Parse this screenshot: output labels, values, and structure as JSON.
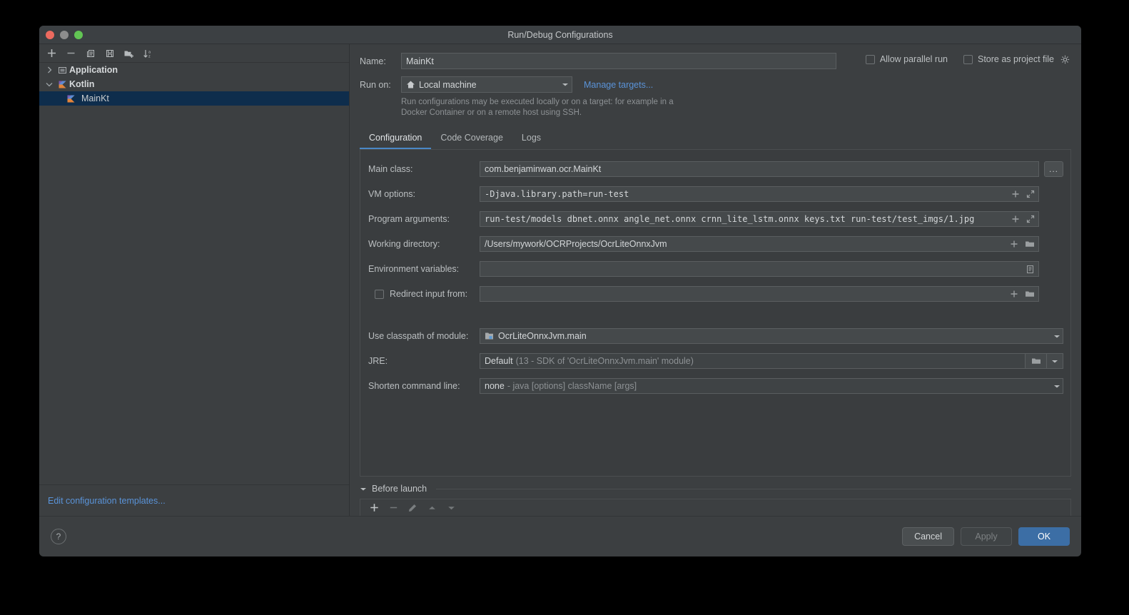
{
  "window": {
    "title": "Run/Debug Configurations",
    "traffic_lights": [
      "close-red",
      "minimize-gray",
      "zoom-green"
    ]
  },
  "tree_toolbar": {
    "buttons": [
      {
        "name": "add-configuration",
        "icon": "plus-icon"
      },
      {
        "name": "remove-configuration",
        "icon": "minus-icon"
      },
      {
        "name": "copy-configuration",
        "icon": "copy-icon"
      },
      {
        "name": "save-configuration",
        "icon": "save-icon"
      },
      {
        "name": "move-into-folder",
        "icon": "folder-add-icon"
      },
      {
        "name": "sort-configurations",
        "icon": "sort-alpha-icon"
      }
    ]
  },
  "tree": {
    "nodes": [
      {
        "label": "Application",
        "type": "group",
        "expanded": false,
        "icon": "application-icon",
        "selected": false
      },
      {
        "label": "Kotlin",
        "type": "group",
        "expanded": true,
        "icon": "kotlin-icon",
        "selected": false
      },
      {
        "label": "MainKt",
        "type": "child",
        "icon": "kotlin-icon",
        "selected": true
      }
    ],
    "footer_link": "Edit configuration templates..."
  },
  "form": {
    "name_label": "Name:",
    "name_value": "MainKt",
    "name_placeholder": "",
    "run_on_label": "Run on:",
    "run_on_value": "Local machine",
    "manage_targets_link": "Manage targets...",
    "hint": "Run configurations may be executed locally or on a target: for example in a Docker Container or on a remote host using SSH.",
    "allow_parallel_run": {
      "label": "Allow parallel run",
      "checked": false
    },
    "store_as_project_file": {
      "label": "Store as project file",
      "checked": false
    }
  },
  "tabs": [
    {
      "label": "Configuration",
      "active": true
    },
    {
      "label": "Code Coverage",
      "active": false
    },
    {
      "label": "Logs",
      "active": false
    }
  ],
  "fields": {
    "main_class": {
      "label": "Main class:",
      "value": "com.benjaminwan.ocr.MainKt",
      "browse_label": "..."
    },
    "vm_options": {
      "label": "VM options:",
      "value": "-Djava.library.path=run-test"
    },
    "program_arguments": {
      "label": "Program arguments:",
      "value": "run-test/models dbnet.onnx angle_net.onnx crnn_lite_lstm.onnx keys.txt run-test/test_imgs/1.jpg"
    },
    "working_directory": {
      "label": "Working directory:",
      "value": "/Users/mywork/OCRProjects/OcrLiteOnnxJvm"
    },
    "environment_variables": {
      "label": "Environment variables:",
      "value": ""
    },
    "redirect_input_from": {
      "label": "Redirect input from:",
      "checked": false,
      "value": ""
    },
    "use_classpath_of_module": {
      "label": "Use classpath of module:",
      "value": "OcrLiteOnnxJvm.main"
    },
    "jre": {
      "label": "JRE:",
      "value": "Default",
      "value_dim": "(13 - SDK of 'OcrLiteOnnxJvm.main' module)"
    },
    "shorten_command_line": {
      "label": "Shorten command line:",
      "value": "none",
      "value_dim": "- java [options] className [args]"
    }
  },
  "before_launch": {
    "title": "Before launch",
    "expanded": true,
    "buttons": [
      {
        "name": "add-task",
        "icon": "plus-icon",
        "enabled": true
      },
      {
        "name": "remove-task",
        "icon": "minus-icon",
        "enabled": false
      },
      {
        "name": "edit-task",
        "icon": "pencil-icon",
        "enabled": false
      },
      {
        "name": "move-task-up",
        "icon": "triangle-up-icon",
        "enabled": false
      },
      {
        "name": "move-task-down",
        "icon": "triangle-down-icon",
        "enabled": false
      }
    ]
  },
  "footer": {
    "help_label": "?",
    "cancel_label": "Cancel",
    "apply_label": "Apply",
    "apply_enabled": false,
    "ok_label": "OK"
  },
  "colors": {
    "dialog_bg": "#3c3f41",
    "input_bg": "#45494b",
    "link": "#5a93d8",
    "accent": "#4a88c7",
    "primary_button": "#3c6ea5",
    "selection": "#0e2d4c"
  }
}
